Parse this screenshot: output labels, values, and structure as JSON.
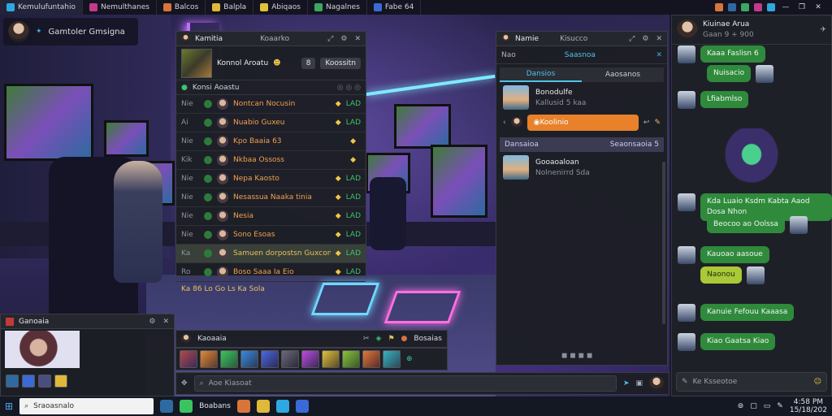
{
  "topbar": {
    "tabs": [
      {
        "label": "Kemulufuntahio",
        "color": "#2ea8e0"
      },
      {
        "label": "Nemulthanes",
        "color": "#c23a8a"
      },
      {
        "label": "Balcos",
        "color": "#d8753a"
      },
      {
        "label": "Balpla",
        "color": "#e0b83a"
      },
      {
        "label": "Abiqaos",
        "color": "#e0c23a"
      },
      {
        "label": "Nagalnes",
        "color": "#3aa860"
      },
      {
        "label": "Fabe 64",
        "color": "#3a6ad8"
      }
    ],
    "window_controls": [
      "—",
      "❐",
      "✕"
    ]
  },
  "streamer": {
    "name": "Gamtoler Gmsigna"
  },
  "lobby": {
    "title": "Kamitia",
    "header_label": "Koaarko",
    "hero_name": "Konnol Aroatu",
    "hero_chip": "Koossitn",
    "hero_chip_num": "8",
    "sub_label": "Konsi Aoastu",
    "rows": [
      {
        "lvl": "Nie",
        "name": "Nontcan Nocusin",
        "status": "LAD"
      },
      {
        "lvl": "Ai",
        "name": "Nuabio Guxeu",
        "status": "LAD"
      },
      {
        "lvl": "Nie",
        "name": "Kpo Baaia 63",
        "status": ""
      },
      {
        "lvl": "Kik",
        "name": "Nkbaa Ossoss",
        "status": ""
      },
      {
        "lvl": "Nie",
        "name": "Nepa Kaosto",
        "status": "LAD"
      },
      {
        "lvl": "Nie",
        "name": "Nesassua Naaka tinia",
        "status": "LAD"
      },
      {
        "lvl": "Nie",
        "name": "Nesia",
        "status": "LAD"
      },
      {
        "lvl": "Nie",
        "name": "Sono Esoas",
        "status": "LAD"
      },
      {
        "lvl": "Ka",
        "name": "Samuen dorpostsn Guxcons",
        "status": "LAD"
      },
      {
        "lvl": "Ro",
        "name": "Boso Saaa Ia Eio",
        "status": "LAD"
      }
    ],
    "footer": "Ka  86  Lo  Go  Ls  Ka Sola"
  },
  "friends": {
    "title": "Namie",
    "header_label": "Kisucco",
    "sub_left": "Nao",
    "sub_center": "Saasnoa",
    "tabs": [
      "Dansios",
      "Aaosanos"
    ],
    "online": [
      {
        "name": "Bonodulfe",
        "sub": "Kallusid 5 kaa"
      }
    ],
    "action_label": "Koolinio",
    "section_left": "Dansaioa",
    "section_right": "Seaonsaoia 5",
    "offline": [
      {
        "name": "Gooaoaloan",
        "sub": "Nolnenirrd Sda"
      }
    ]
  },
  "chat": {
    "name": "Kiuinae Arua",
    "status": "Gaan 9 + 900",
    "messages": [
      {
        "text": "Kaaa Faslisn 6",
        "side": "left"
      },
      {
        "text": "Nuisacio",
        "side": "right"
      },
      {
        "text": "Lfiabmlso",
        "side": "left"
      },
      {
        "text": "Kda Luaio Ksdm Kabta Aaod Dosa Nhon",
        "side": "left"
      },
      {
        "text": "Beocoo ao Oolssa",
        "side": "right"
      },
      {
        "text": "Kauoao aasoue",
        "side": "left"
      },
      {
        "text": "Naonou",
        "side": "right",
        "lime": true
      },
      {
        "text": "Kanuie Fefouu Kaaasa",
        "side": "left"
      },
      {
        "text": "Kiao Gaatsa Kiao",
        "side": "left"
      }
    ],
    "input_placeholder": "Ke  Ksseotoe"
  },
  "toolbar": {
    "label": "Kaoaaia",
    "right_label": "Bosaias"
  },
  "search": {
    "placeholder": "Aoe Kiasoat"
  },
  "webcam": {
    "title": "Ganoaia"
  },
  "taskbar": {
    "search_placeholder": "Sraoasnalo",
    "app_label": "Boabans",
    "time": "4:58 PM",
    "date": "15/18/202"
  }
}
